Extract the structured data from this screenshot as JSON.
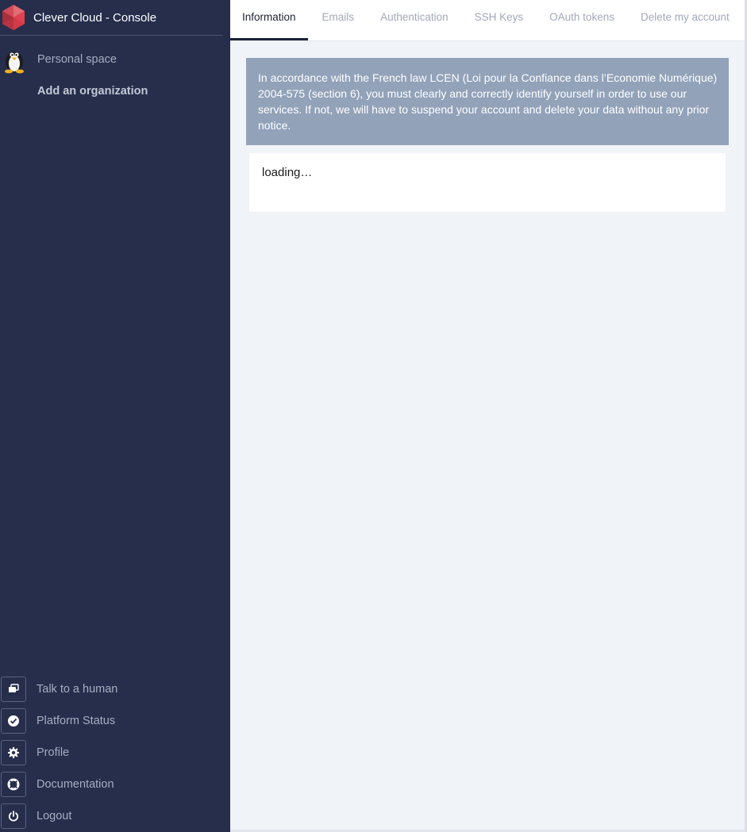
{
  "app": {
    "title": "Clever Cloud - Console",
    "logo_icon": "clever-cloud-logo-icon"
  },
  "sidebar": {
    "top_items": [
      {
        "label": "Personal space",
        "icon": "penguin-avatar-icon"
      },
      {
        "label": "Add an organization"
      }
    ],
    "bottom_items": [
      {
        "label": "Talk to a human",
        "icon": "chat-icon"
      },
      {
        "label": "Platform Status",
        "icon": "check-circle-icon"
      },
      {
        "label": "Profile",
        "icon": "gear-icon"
      },
      {
        "label": "Documentation",
        "icon": "lifebuoy-icon"
      },
      {
        "label": "Logout",
        "icon": "power-icon"
      }
    ]
  },
  "tabs": [
    {
      "label": "Information",
      "active": true
    },
    {
      "label": "Emails",
      "active": false
    },
    {
      "label": "Authentication",
      "active": false
    },
    {
      "label": "SSH Keys",
      "active": false
    },
    {
      "label": "OAuth tokens",
      "active": false
    },
    {
      "label": "Delete my account",
      "active": false
    }
  ],
  "notice": {
    "text": "In accordance with the French law LCEN (Loi pour la Confiance dans l’Economie Numérique) 2004-575 (section 6), you must clearly and correctly identify yourself in order to use our services. If not, we will have to suspend your account and delete your data without any prior notice."
  },
  "content": {
    "status": "loading…"
  },
  "colors": {
    "sidebar_bg": "#262e4c",
    "notice_bg": "#92a2b9",
    "main_bg": "#f0f3f8",
    "brand_red": "#e0414e"
  }
}
